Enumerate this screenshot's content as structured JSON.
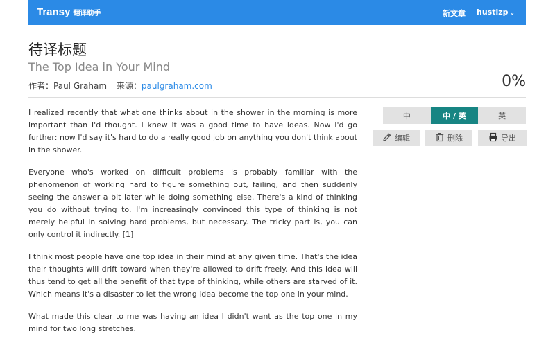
{
  "navbar": {
    "brand": "Transy",
    "brand_sub": "翻译助手",
    "new_article": "新文章",
    "user": "hustlzp",
    "user_caret": "⌄"
  },
  "article": {
    "title_label": "待译标题",
    "title": "The Top Idea in Your Mind",
    "author_label": "作者：",
    "author": "Paul Graham",
    "source_label": "来源：",
    "source": "paulgraham.com",
    "progress": "0%",
    "paragraphs": [
      "I realized recently that what one thinks about in the shower in the morning is more important than I'd thought. I knew it was a good time to have ideas. Now I'd go further: now I'd say it's hard to do a really good job on anything you don't think about in the shower.",
      "Everyone who's worked on difficult problems is probably familiar with the phenomenon of working hard to figure something out, failing, and then suddenly seeing the answer a bit later while doing something else. There's a kind of thinking you do without trying to. I'm increasingly convinced this type of thinking is not merely helpful in solving hard problems, but necessary. The tricky part is, you can only control it indirectly. [1]",
      "I think most people have one top idea in their mind at any given time. That's the idea their thoughts will drift toward when they're allowed to drift freely. And this idea will thus tend to get all the benefit of that type of thinking, while others are starved of it. Which means it's a disaster to let the wrong idea become the top one in your mind.",
      "What made this clear to me was having an idea I didn't want as the top one in my mind for two long stretches."
    ]
  },
  "sidebar": {
    "lang_options": [
      "中",
      "中 / 英",
      "英"
    ],
    "active_lang": "中 / 英",
    "edit_label": "编辑",
    "delete_label": "删除",
    "export_label": "导出"
  },
  "colors": {
    "navbar": "#2b8ae6",
    "active_toggle": "#178583",
    "button_bg": "#e2e2e2",
    "link": "#2b8ae6"
  },
  "icons": {
    "edit": "pencil-icon",
    "delete": "trash-icon",
    "export": "printer-icon"
  }
}
